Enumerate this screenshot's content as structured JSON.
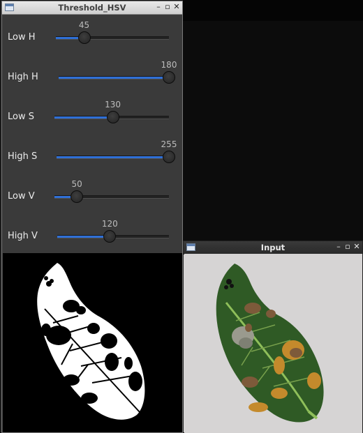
{
  "threshold_window": {
    "title": "Threshold_HSV",
    "sliders": [
      {
        "label": "Low H",
        "value": 45,
        "max": 180
      },
      {
        "label": "High H",
        "value": 180,
        "max": 180
      },
      {
        "label": "Low S",
        "value": 130,
        "max": 255
      },
      {
        "label": "High S",
        "value": 255,
        "max": 255
      },
      {
        "label": "Low V",
        "value": 50,
        "max": 255
      },
      {
        "label": "High V",
        "value": 120,
        "max": 255
      }
    ]
  },
  "input_window": {
    "title": "Input"
  },
  "colors": {
    "slider_fill": "#2f6fd6",
    "leaf_dark_green": "#2f5a25",
    "leaf_stem": "#8fbf5a",
    "lesion_brown": "#7d5a3a",
    "lesion_tan": "#c48a2c",
    "input_background": "#d6d4d4"
  }
}
